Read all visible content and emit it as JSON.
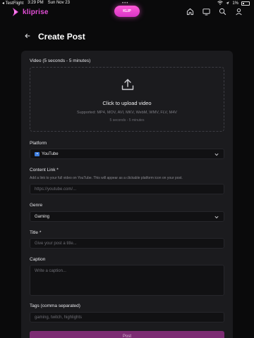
{
  "status_bar": {
    "carrier": "◂ TestFlight",
    "time": "3:29 PM",
    "date": "Sun Nov 23",
    "dots": "•••",
    "battery_percent": "1%"
  },
  "nav": {
    "brand": "kliprise",
    "klip_label": "KLIP",
    "icons": [
      "home-icon",
      "tv-icon",
      "search-icon",
      "profile-icon"
    ]
  },
  "header": {
    "title": "Create Post"
  },
  "form": {
    "video_label": "Video (5 seconds - 5 minutes)",
    "upload_title": "Click to upload video",
    "upload_formats": "Supported: MP4, MOV, AVI, MKV, WebM, WMV, FLV, M4V",
    "upload_duration": "5 seconds - 5 minutes",
    "platform_label": "Platform",
    "platform_value": "YouTube",
    "content_link_label": "Content Link *",
    "content_link_help": "Add a link to your full video on YouTube. This will appear as a clickable platform icon on your post.",
    "content_link_placeholder": "https://youtube.com/...",
    "genre_label": "Genre",
    "genre_value": "Gaming",
    "title_label": "Title *",
    "title_placeholder": "Give your post a title...",
    "caption_label": "Caption",
    "caption_placeholder": "Write a caption...",
    "tags_label": "Tags (comma separated)",
    "tags_placeholder": "gaming, twitch, highlights",
    "submit_label": "Post"
  },
  "colors": {
    "brand": "#e34fd7",
    "background": "#0a0a0b",
    "card": "#1b1b1e",
    "submit": "#7c2c73"
  }
}
